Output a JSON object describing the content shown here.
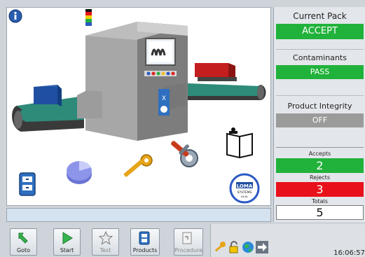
{
  "right_panel": {
    "current_pack": {
      "title": "Current Pack",
      "value": "ACCEPT"
    },
    "contaminants": {
      "title": "Contaminants",
      "value": "PASS"
    },
    "product_integrity": {
      "title": "Product Integrity",
      "value": "OFF"
    },
    "counters": {
      "accepts": {
        "label": "Accepts",
        "value": "2"
      },
      "rejects": {
        "label": "Rejects",
        "value": "3"
      },
      "totals": {
        "label": "Totals",
        "value": "5"
      }
    }
  },
  "machine": {
    "panel_letter": "X"
  },
  "logo": {
    "name": "LOMA",
    "sub": "SYSTEMS",
    "region": "UK.KL"
  },
  "toolbar": {
    "goto": "Goto",
    "start": "Start",
    "test": "Test",
    "products": "Products",
    "procedure": "Procedure"
  },
  "taskbar": {
    "clock": "16:06:57"
  },
  "colors": {
    "accept": "#21b23b",
    "reject": "#e8101a",
    "off": "#9b9b9b"
  }
}
